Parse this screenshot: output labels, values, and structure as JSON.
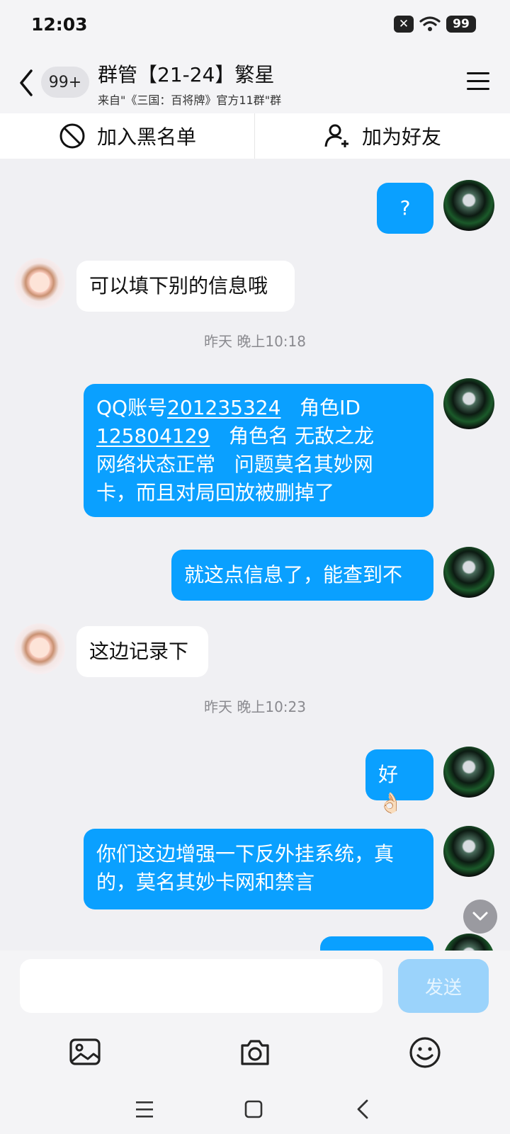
{
  "status": {
    "time": "12:03",
    "battery": "99"
  },
  "header": {
    "unread_badge": "99+",
    "title": "群管【21-24】繁星",
    "subtitle": "来自\"《三国：百将牌》官方11群\"群"
  },
  "actions": {
    "blacklist": "加入黑名单",
    "add_friend": "加为好友"
  },
  "messages": [
    {
      "from": "me",
      "text": "?"
    },
    {
      "from": "them",
      "text": "可以填下别的信息哦"
    },
    {
      "type": "time",
      "text": "昨天 晚上10:18"
    },
    {
      "from": "me",
      "line1_prefix": "QQ账号",
      "qq": "201235324",
      "line1_suffix": "   角色ID",
      "role_id": "125804129",
      "line2_suffix": "   角色名 无敌之龙",
      "line3": "网络状态正常   问题莫名其妙网",
      "line4": "卡，而且对局回放被删掉了"
    },
    {
      "from": "me",
      "text": "就这点信息了，能查到不"
    },
    {
      "from": "them",
      "text": "这边记录下"
    },
    {
      "type": "time",
      "text": "昨天 晚上10:23"
    },
    {
      "from": "me",
      "text": "好👌🏻"
    },
    {
      "from": "me",
      "line1": "你们这边增强一下反外挂系统，真",
      "line2": "的，莫名其妙卡网和禁言"
    }
  ],
  "input": {
    "placeholder": "",
    "send_label": "发送"
  }
}
